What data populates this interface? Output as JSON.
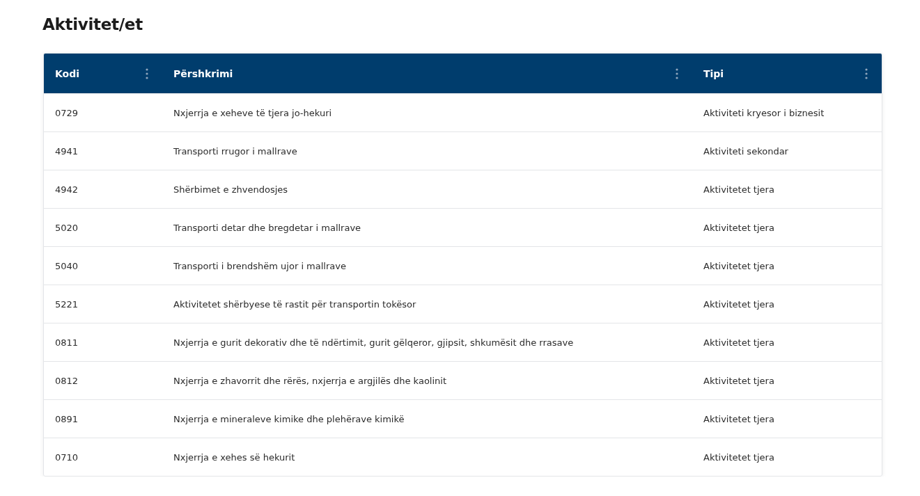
{
  "title": "Aktivitet/et",
  "table": {
    "columns": [
      "Kodi",
      "Përshkrimi",
      "Tipi"
    ],
    "rows": [
      [
        "0729",
        "Nxjerrja e xeheve të tjera jo-hekuri",
        "Aktiviteti kryesor i biznesit"
      ],
      [
        "4941",
        "Transporti rrugor i mallrave",
        "Aktiviteti sekondar"
      ],
      [
        "4942",
        "Shërbimet e zhvendosjes",
        "Aktivitetet tjera"
      ],
      [
        "5020",
        "Transporti detar dhe bregdetar i mallrave",
        "Aktivitetet tjera"
      ],
      [
        "5040",
        "Transporti i brendshëm ujor i mallrave",
        "Aktivitetet tjera"
      ],
      [
        "5221",
        "Aktivitetet shërbyese të rastit për transportin tokësor",
        "Aktivitetet tjera"
      ],
      [
        "0811",
        "Nxjerrja e gurit dekorativ dhe të ndërtimit, gurit gëlqeror, gjipsit, shkumësit dhe rrasave",
        "Aktivitetet tjera"
      ],
      [
        "0812",
        "Nxjerrja e zhavorrit dhe rërës, nxjerrja e argjilës dhe kaolinit",
        "Aktivitetet tjera"
      ],
      [
        "0891",
        "Nxjerrja e mineraleve kimike dhe plehërave kimikë",
        "Aktivitetet tjera"
      ],
      [
        "0710",
        "Nxjerrja e xehes së hekurit",
        "Aktivitetet tjera"
      ]
    ]
  }
}
